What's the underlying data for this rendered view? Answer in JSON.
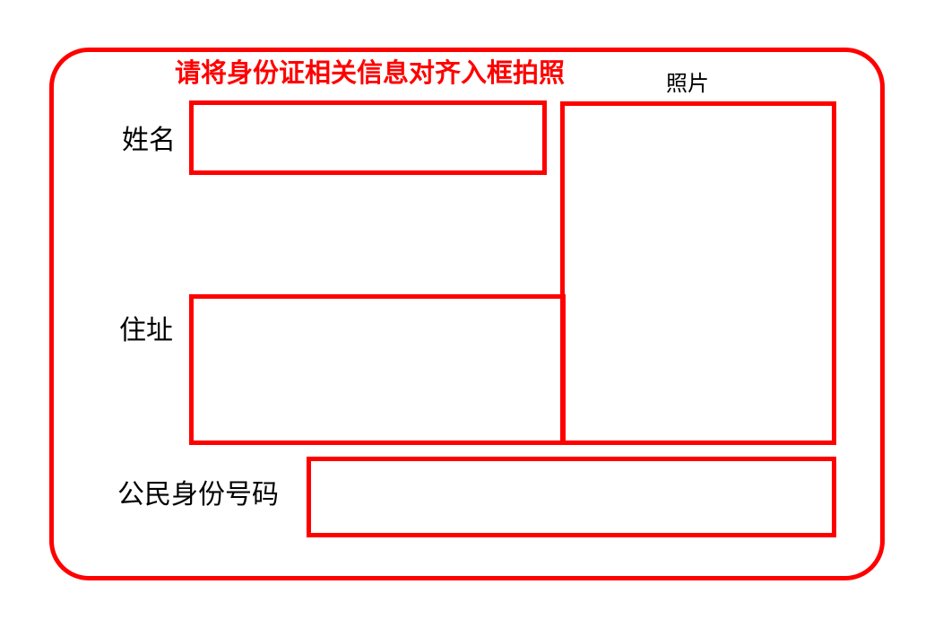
{
  "instruction": "请将身份证相关信息对齐入框拍照",
  "photo": {
    "label": "照片"
  },
  "fields": {
    "name": {
      "label": "姓名"
    },
    "address": {
      "label": "住址"
    },
    "id_number": {
      "label": "公民身份号码"
    }
  },
  "colors": {
    "frame": "#ff0000",
    "label_text": "#000000"
  }
}
